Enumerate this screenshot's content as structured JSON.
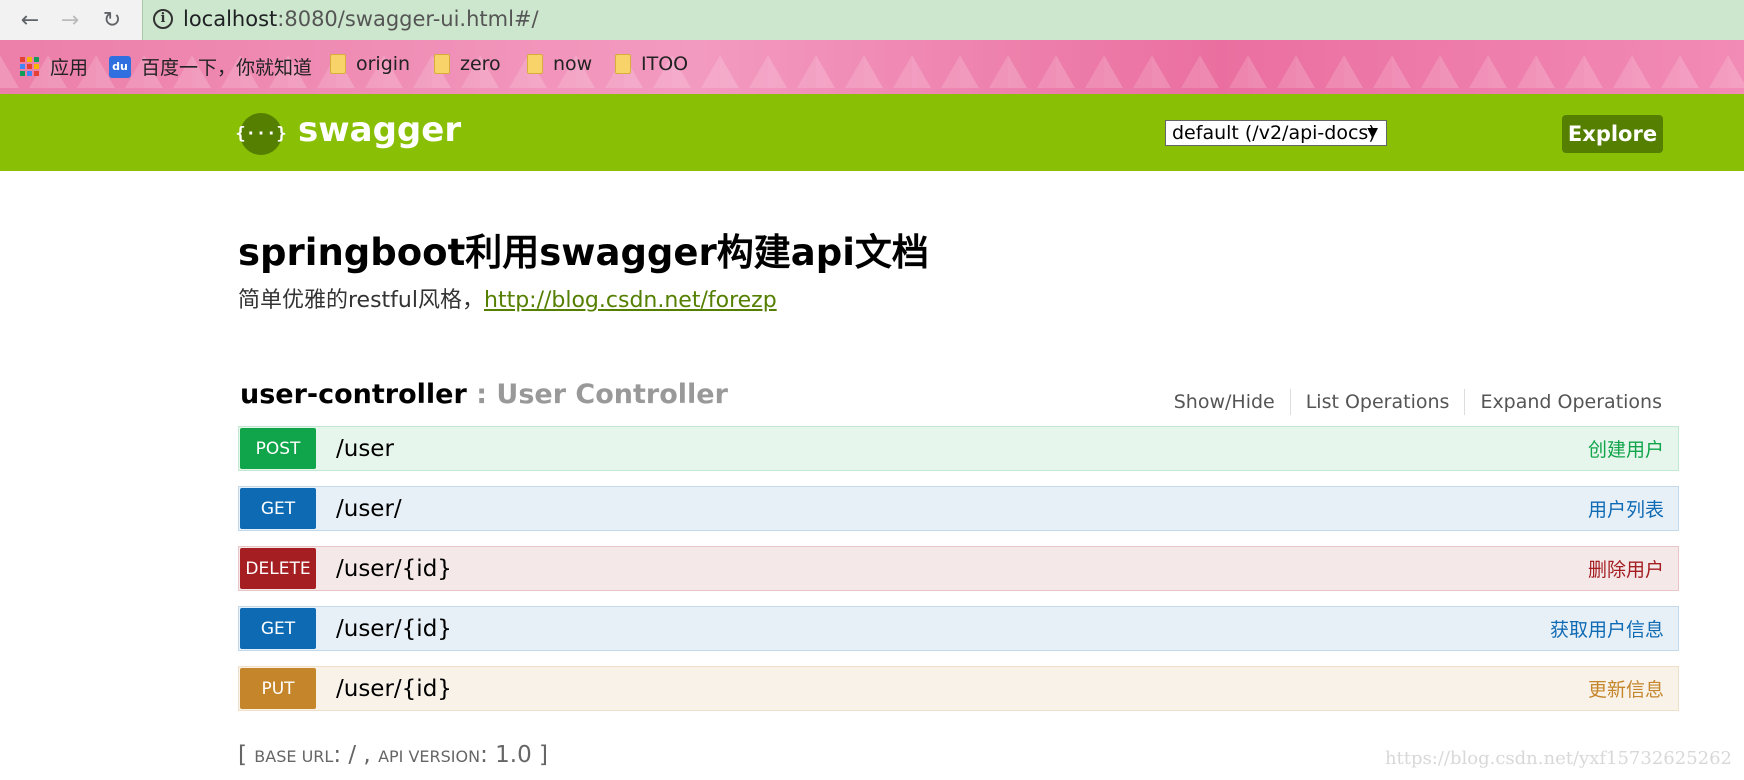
{
  "browser": {
    "url_host": "localhost",
    "url_rest": ":8080/swagger-ui.html#/",
    "bookmarks": [
      {
        "label": "应用",
        "icon": "apps-grid-icon"
      },
      {
        "label": "百度一下，你就知道",
        "icon": "baidu-icon"
      },
      {
        "label": "origin",
        "icon": "folder-icon"
      },
      {
        "label": "zero",
        "icon": "folder-icon"
      },
      {
        "label": "now",
        "icon": "folder-icon"
      },
      {
        "label": "ITOO",
        "icon": "folder-icon"
      }
    ],
    "baidu_icon_text": "du"
  },
  "header": {
    "logo_text": "{···}",
    "title": "swagger",
    "api_select": "default (/v2/api-docs)",
    "explore_label": "Explore",
    "accent": "#89bf04",
    "accent_dark": "#547f00"
  },
  "info": {
    "title": "springboot利用swagger构建api文档",
    "description": "简单优雅的restful风格，",
    "link": "http://blog.csdn.net/forezp"
  },
  "resource": {
    "name": "user-controller",
    "description": " : User Controller",
    "links": [
      "Show/Hide",
      "List Operations",
      "Expand Operations"
    ]
  },
  "operations": [
    {
      "method": "POST",
      "path": "/user",
      "summary": "创建用户",
      "color": "#10a54a"
    },
    {
      "method": "GET",
      "path": "/user/",
      "summary": "用户列表",
      "color": "#0f6ab4"
    },
    {
      "method": "DELETE",
      "path": "/user/{id}",
      "summary": "删除用户",
      "color": "#a41e22"
    },
    {
      "method": "GET",
      "path": "/user/{id}",
      "summary": "获取用户信息",
      "color": "#0f6ab4"
    },
    {
      "method": "PUT",
      "path": "/user/{id}",
      "summary": "更新信息",
      "color": "#c5862b"
    }
  ],
  "footer": {
    "open": "[ ",
    "base_url_label": "Base url",
    "base_url_value": ": / , ",
    "api_version_label": "api version",
    "api_version_value": ": 1.0 ]"
  },
  "watermark": "https://blog.csdn.net/yxf15732625262"
}
